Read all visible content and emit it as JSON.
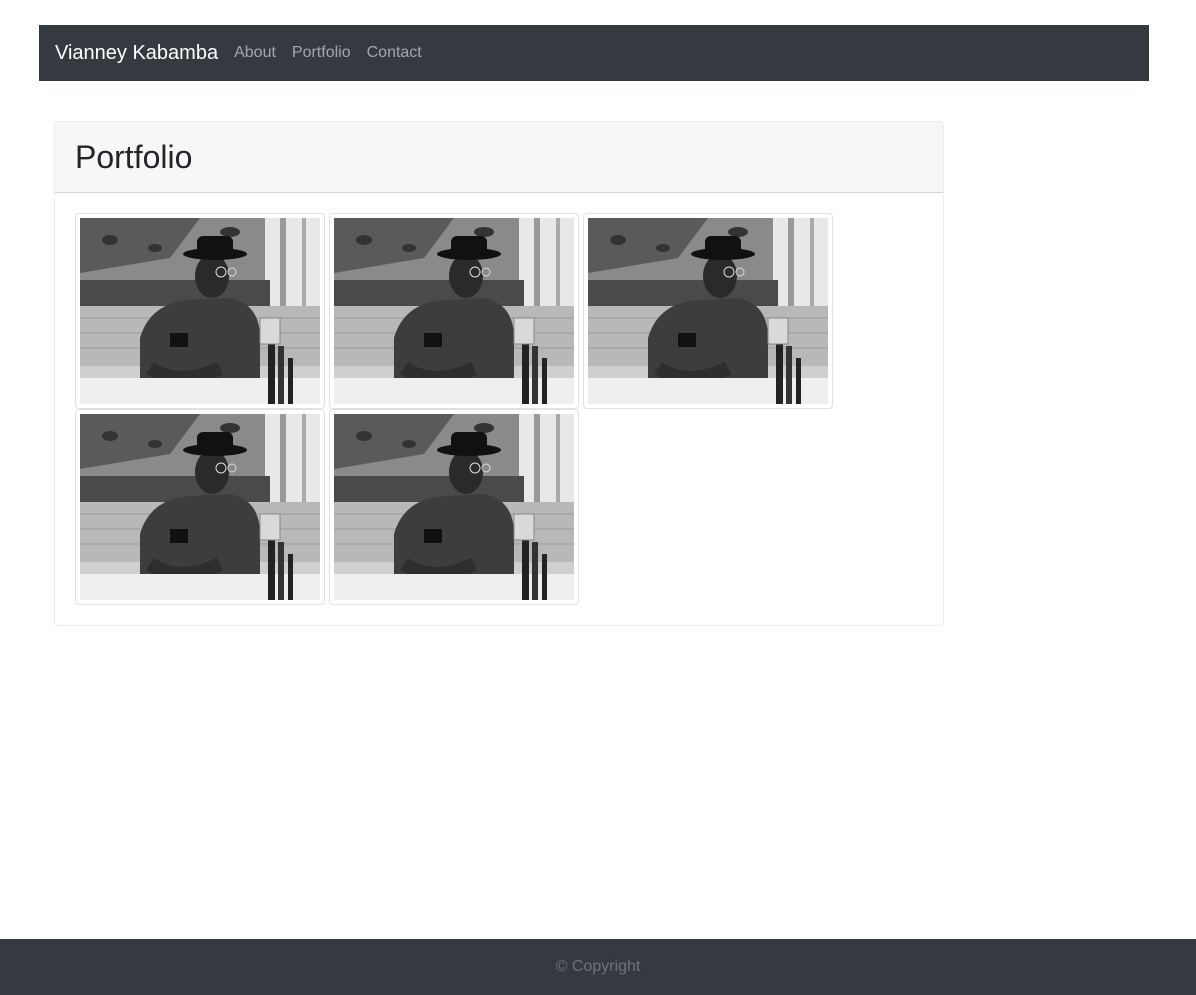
{
  "navbar": {
    "brand": "Vianney Kabamba",
    "links": [
      "About",
      "Portfolio",
      "Contact"
    ]
  },
  "portfolio": {
    "title": "Portfolio",
    "images": [
      {
        "alt": "portfolio photo"
      },
      {
        "alt": "portfolio photo"
      },
      {
        "alt": "portfolio photo"
      },
      {
        "alt": "portfolio photo"
      },
      {
        "alt": "portfolio photo"
      }
    ]
  },
  "footer": {
    "text": "© Copyright"
  },
  "colors": {
    "navbar_bg": "#343a40",
    "footer_bg": "#343a40",
    "card_header_bg": "#f7f7f7"
  }
}
